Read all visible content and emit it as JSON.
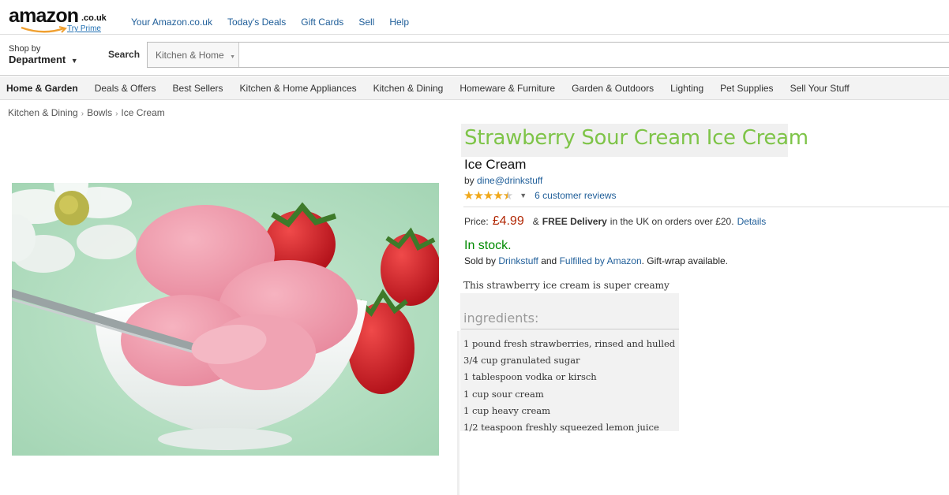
{
  "header": {
    "logo_text": "amazon",
    "logo_tld": ".co.uk",
    "try_prime": "Try Prime",
    "nav": [
      "Your Amazon.co.uk",
      "Today's Deals",
      "Gift Cards",
      "Sell",
      "Help"
    ]
  },
  "search": {
    "shop_by": "Shop by",
    "department": "Department",
    "label": "Search",
    "category": "Kitchen & Home"
  },
  "category_nav": [
    "Home & Garden",
    "Deals & Offers",
    "Best Sellers",
    "Kitchen & Home Appliances",
    "Kitchen & Dining",
    "Homeware & Furniture",
    "Garden & Outdoors",
    "Lighting",
    "Pet Supplies",
    "Sell Your Stuff"
  ],
  "breadcrumb": [
    "Kitchen & Dining",
    "Bowls",
    "Ice Cream"
  ],
  "product": {
    "title": "Strawberry Sour Cream Ice Cream",
    "subtitle": "Ice Cream",
    "by_label": "by",
    "brand": "dine@drinkstuff",
    "rating": 4.5,
    "reviews": "6 customer reviews",
    "price_label": "Price:",
    "price": "£4.99",
    "delivery_prefix": "&",
    "free_delivery": "FREE Delivery",
    "delivery_text": "in the UK on orders over £20.",
    "details": "Details",
    "stock": "In stock.",
    "sold_by_label": "Sold by",
    "seller": "Drinkstuff",
    "and": "and",
    "fulfilled": "Fulfilled by Amazon",
    "giftwrap": ". Gift-wrap available."
  },
  "recipe": {
    "description": "This strawberry ice cream is super creamy",
    "ingredients_heading": "ingredients:",
    "ingredients": [
      "1 pound fresh strawberries, rinsed and hulled",
      "3/4 cup granulated sugar",
      "1 tablespoon vodka or kirsch",
      "1 cup sour cream",
      "1 cup heavy cream",
      "1/2 teaspoon freshly squeezed lemon juice"
    ]
  }
}
